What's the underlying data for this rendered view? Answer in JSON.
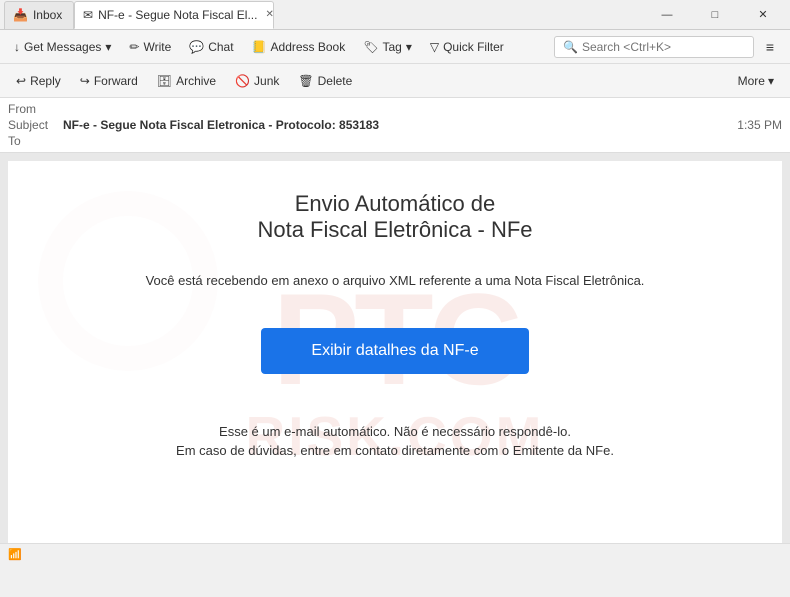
{
  "titlebar": {
    "tab_inbox_label": "Inbox",
    "tab_email_label": "NF-e - Segue Nota Fiscal El...",
    "window_minimize": "—",
    "window_maximize": "□",
    "window_close": "✕"
  },
  "toolbar": {
    "get_messages_label": "Get Messages",
    "write_label": "Write",
    "chat_label": "Chat",
    "address_book_label": "Address Book",
    "tag_label": "Tag",
    "quick_filter_label": "Quick Filter",
    "search_placeholder": "Search <Ctrl+K>",
    "hamburger_label": "≡"
  },
  "action_bar": {
    "reply_label": "Reply",
    "forward_label": "Forward",
    "archive_label": "Archive",
    "junk_label": "Junk",
    "delete_label": "Delete",
    "more_label": "More"
  },
  "email_header": {
    "from_label": "From",
    "from_value": "",
    "subject_label": "Subject",
    "subject_value": "NF-e - Segue Nota Fiscal Eletronica - Protocolo: 853183",
    "to_label": "To",
    "to_value": "",
    "time_value": "1:35 PM"
  },
  "email_body": {
    "title_line1": "Envio Automático de",
    "title_line2": "Nota Fiscal Eletrônica - NFe",
    "subtitle": "Você está recebendo em anexo o arquivo XML referente a uma Nota Fiscal Eletrônica.",
    "cta_button_label": "Exibir datalhes da NF-e",
    "footer_line1": "Esse é um e-mail automático. Não é necessário respondê-lo.",
    "footer_line2": "Em caso de dúvidas, entre em contato diretamente com o Emitente da NFe."
  },
  "status_bar": {
    "icon": "📶"
  }
}
